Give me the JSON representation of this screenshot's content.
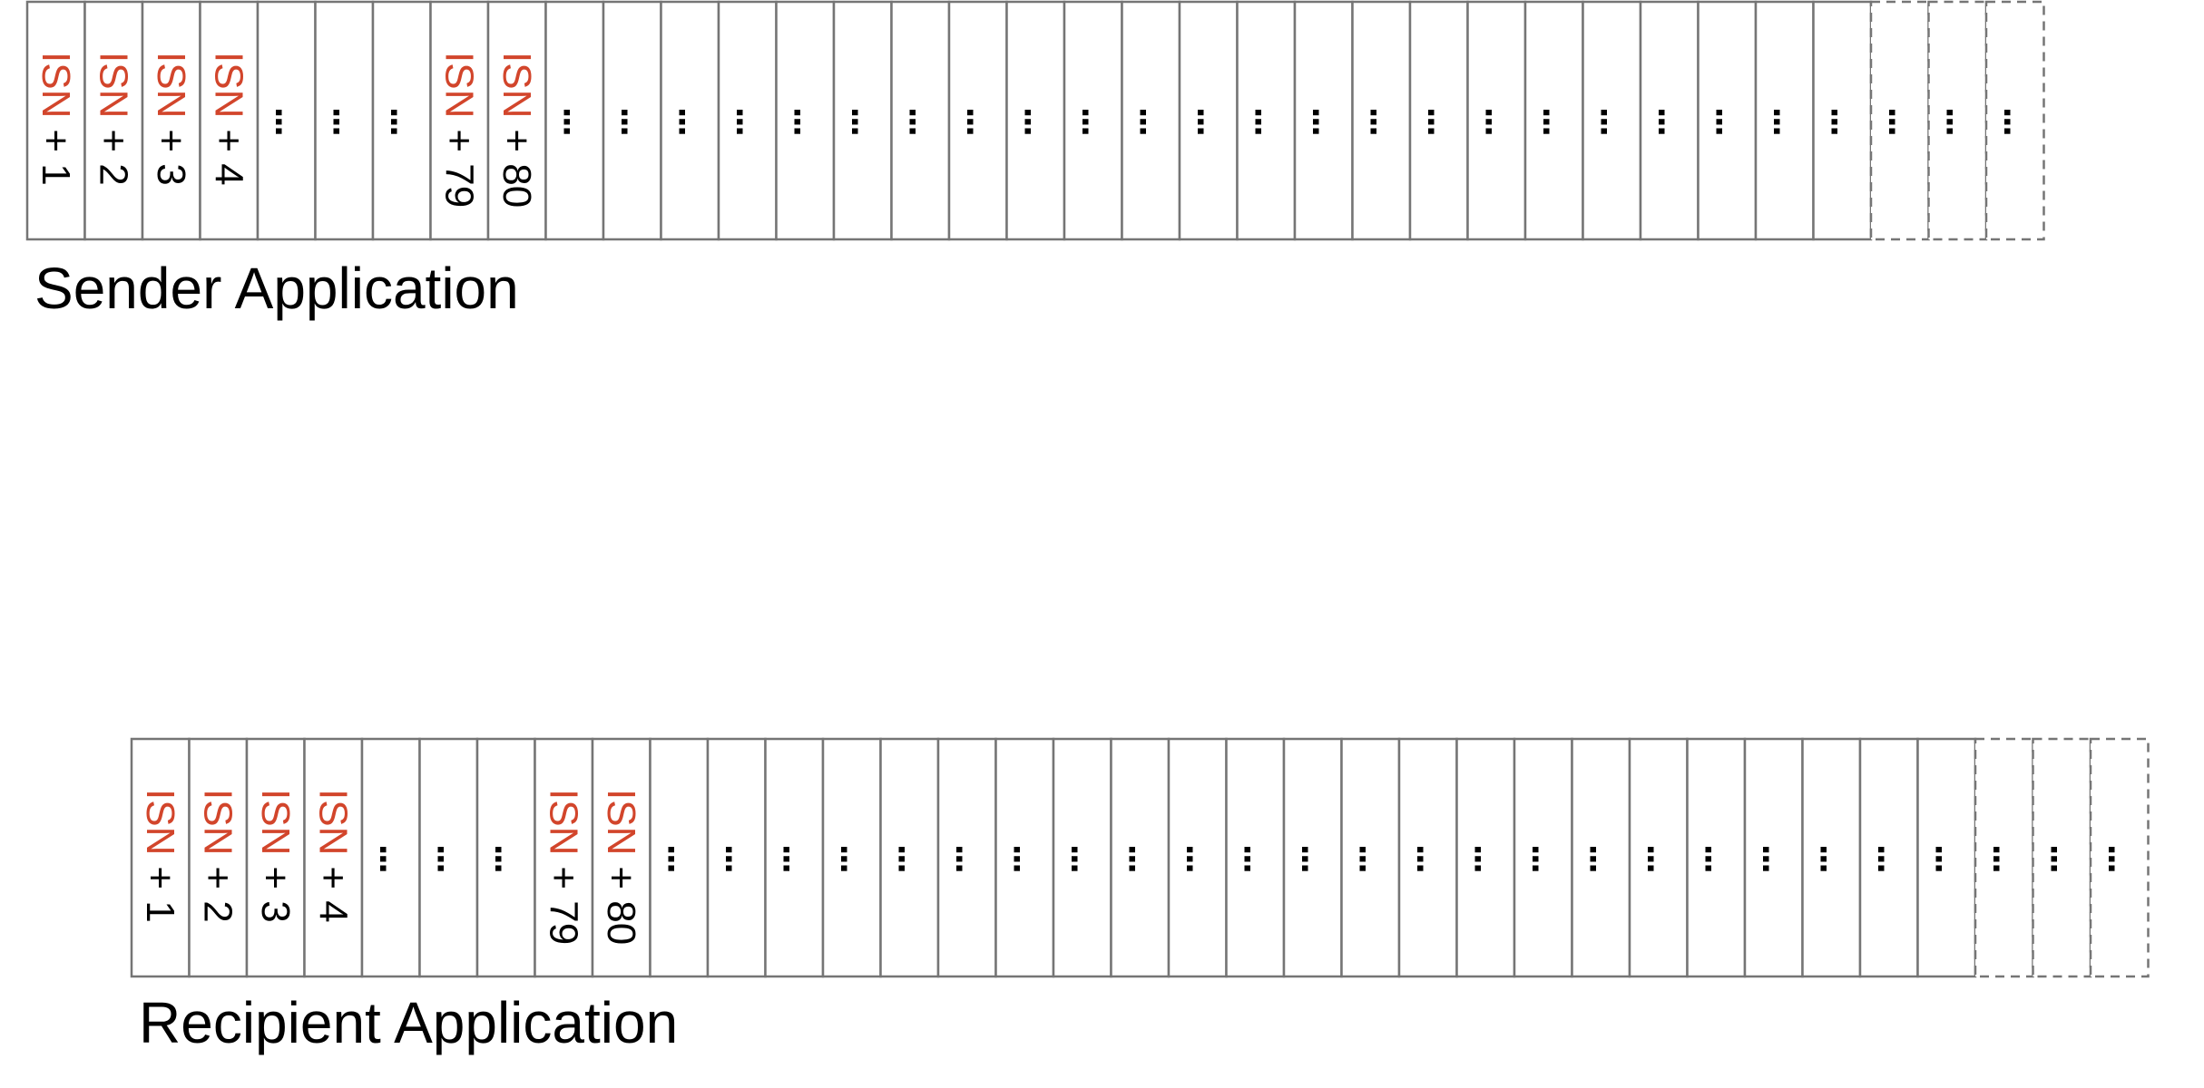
{
  "colors": {
    "cell_border": "#757575",
    "isn_text": "#d2452b",
    "offset_text": "#000000",
    "ellipsis": "#000000"
  },
  "buffers": [
    {
      "id": "sender",
      "label": "Sender Application",
      "cells": [
        {
          "isn": "ISN",
          "offset": "+ 1"
        },
        {
          "isn": "ISN",
          "offset": "+ 2"
        },
        {
          "isn": "ISN",
          "offset": "+ 3"
        },
        {
          "isn": "ISN",
          "offset": "+ 4"
        },
        {
          "ellipsis": "..."
        },
        {
          "ellipsis": "..."
        },
        {
          "ellipsis": "..."
        },
        {
          "isn": "ISN",
          "offset": "+ 79"
        },
        {
          "isn": "ISN",
          "offset": "+ 80"
        },
        {
          "ellipsis": "..."
        },
        {
          "ellipsis": "..."
        },
        {
          "ellipsis": "..."
        },
        {
          "ellipsis": "..."
        },
        {
          "ellipsis": "..."
        },
        {
          "ellipsis": "..."
        },
        {
          "ellipsis": "..."
        },
        {
          "ellipsis": "..."
        },
        {
          "ellipsis": "..."
        },
        {
          "ellipsis": "..."
        },
        {
          "ellipsis": "..."
        },
        {
          "ellipsis": "..."
        },
        {
          "ellipsis": "..."
        },
        {
          "ellipsis": "..."
        },
        {
          "ellipsis": "..."
        },
        {
          "ellipsis": "..."
        },
        {
          "ellipsis": "..."
        },
        {
          "ellipsis": "..."
        },
        {
          "ellipsis": "..."
        },
        {
          "ellipsis": "..."
        },
        {
          "ellipsis": "..."
        },
        {
          "ellipsis": "..."
        },
        {
          "ellipsis": "..."
        },
        {
          "ellipsis": "...",
          "dashed": true
        },
        {
          "ellipsis": "...",
          "dashed": true
        },
        {
          "ellipsis": "...",
          "dashed": true
        }
      ]
    },
    {
      "id": "recipient",
      "label": "Recipient Application",
      "cells": [
        {
          "isn": "ISN",
          "offset": "+ 1"
        },
        {
          "isn": "ISN",
          "offset": "+ 2"
        },
        {
          "isn": "ISN",
          "offset": "+ 3"
        },
        {
          "isn": "ISN",
          "offset": "+ 4"
        },
        {
          "ellipsis": "..."
        },
        {
          "ellipsis": "..."
        },
        {
          "ellipsis": "..."
        },
        {
          "isn": "ISN",
          "offset": "+ 79"
        },
        {
          "isn": "ISN",
          "offset": "+ 80"
        },
        {
          "ellipsis": "..."
        },
        {
          "ellipsis": "..."
        },
        {
          "ellipsis": "..."
        },
        {
          "ellipsis": "..."
        },
        {
          "ellipsis": "..."
        },
        {
          "ellipsis": "..."
        },
        {
          "ellipsis": "..."
        },
        {
          "ellipsis": "..."
        },
        {
          "ellipsis": "..."
        },
        {
          "ellipsis": "..."
        },
        {
          "ellipsis": "..."
        },
        {
          "ellipsis": "..."
        },
        {
          "ellipsis": "..."
        },
        {
          "ellipsis": "..."
        },
        {
          "ellipsis": "..."
        },
        {
          "ellipsis": "..."
        },
        {
          "ellipsis": "..."
        },
        {
          "ellipsis": "..."
        },
        {
          "ellipsis": "..."
        },
        {
          "ellipsis": "..."
        },
        {
          "ellipsis": "..."
        },
        {
          "ellipsis": "..."
        },
        {
          "ellipsis": "..."
        },
        {
          "ellipsis": "...",
          "dashed": true
        },
        {
          "ellipsis": "...",
          "dashed": true
        },
        {
          "ellipsis": "...",
          "dashed": true
        }
      ]
    }
  ]
}
